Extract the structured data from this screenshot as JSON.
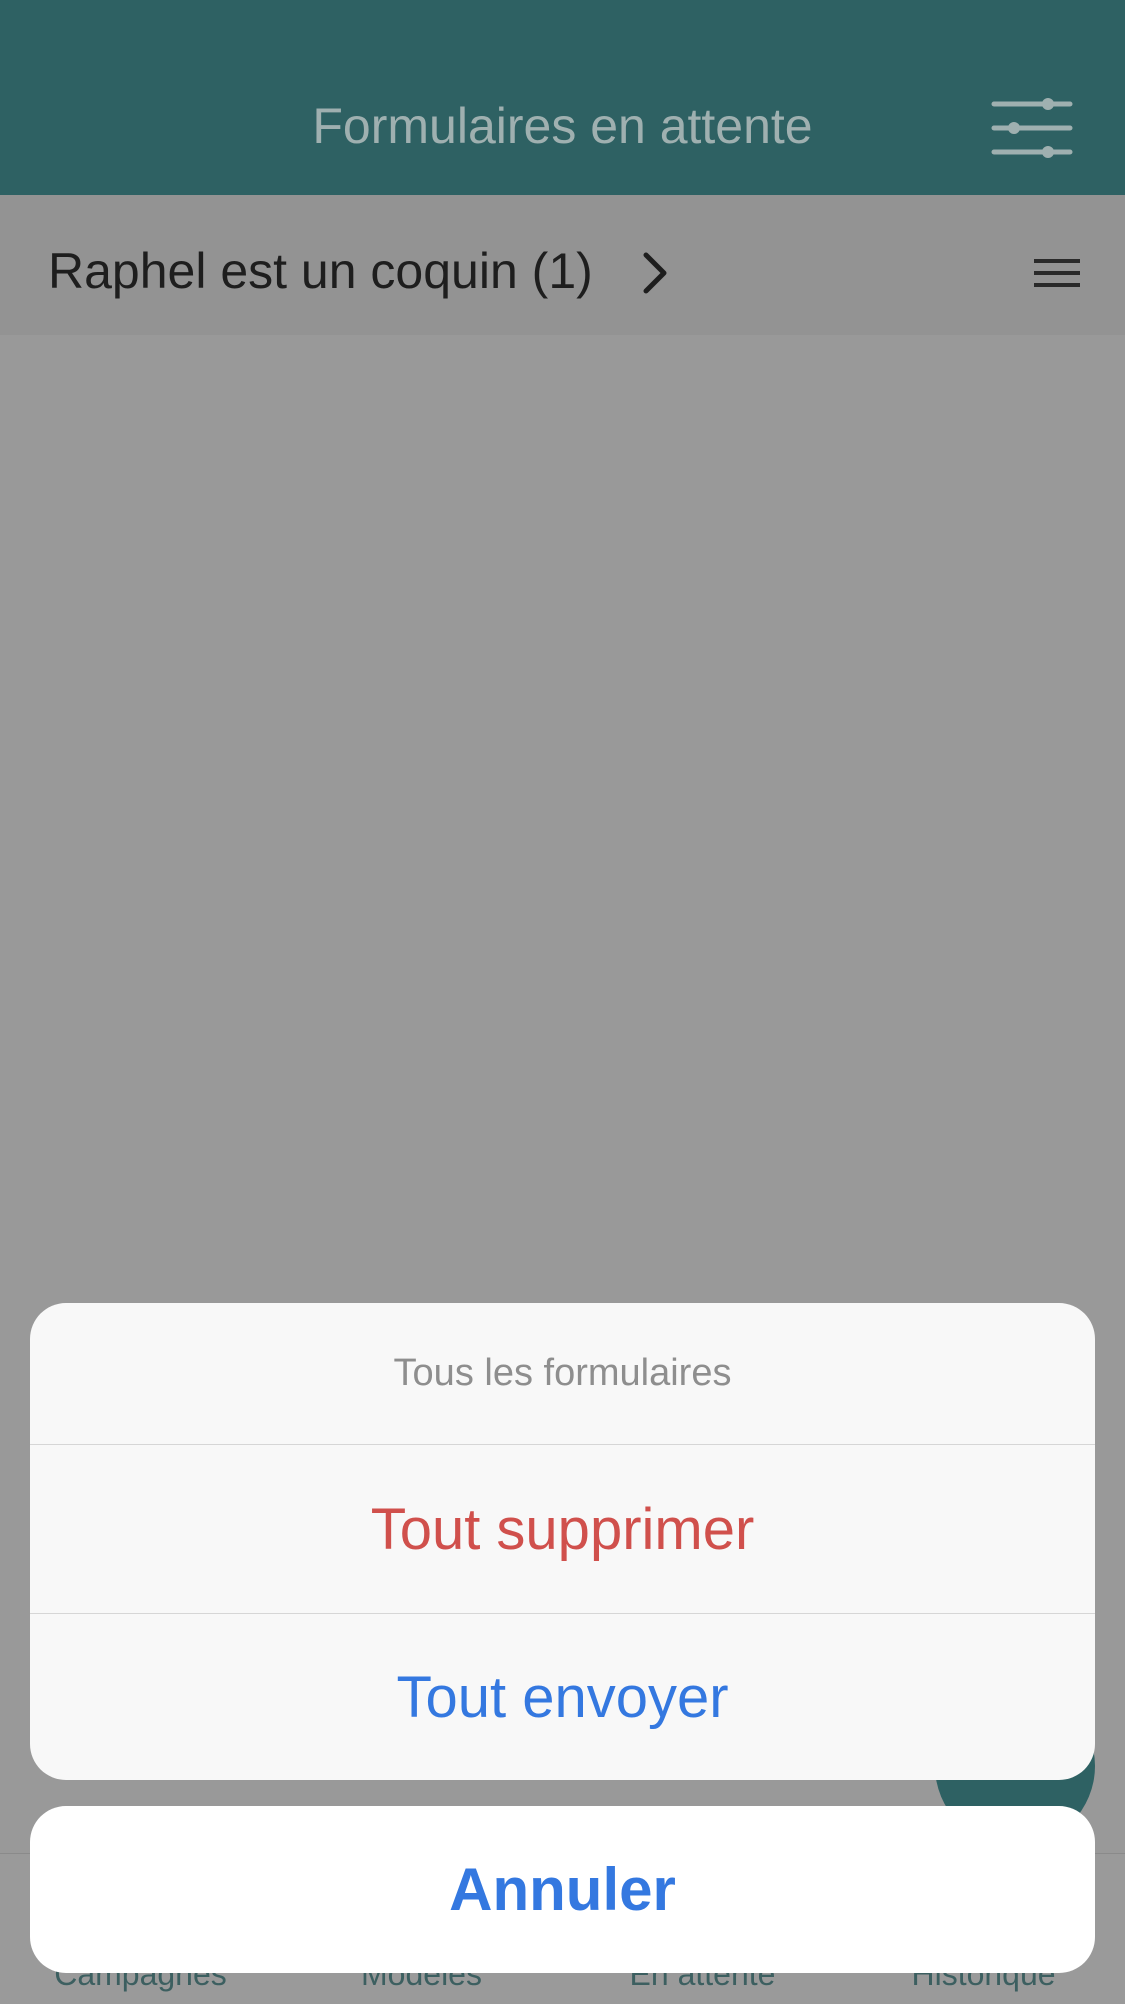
{
  "header": {
    "title": "Formulaires en attente",
    "filter_icon": "sliders-icon",
    "color": "#2e6163"
  },
  "group": {
    "label": "Raphel est un coquin (1)",
    "chevron_icon": "chevron-right-icon",
    "menu_icon": "hamburger-icon"
  },
  "tabbar": {
    "tabs": [
      {
        "label": "Campagnes"
      },
      {
        "label": "Modèles"
      },
      {
        "label": "En attente"
      },
      {
        "label": "Historique"
      }
    ]
  },
  "action_sheet": {
    "title": "Tous les formulaires",
    "delete_label": "Tout supprimer",
    "send_label": "Tout envoyer",
    "cancel_label": "Annuler",
    "destructive_color": "#d0504c",
    "accent_color": "#3478e0"
  }
}
